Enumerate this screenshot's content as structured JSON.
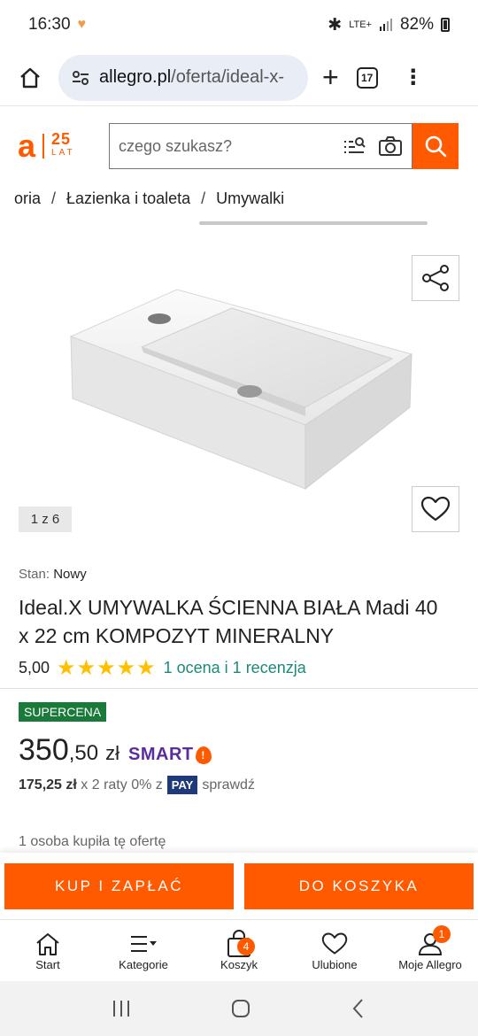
{
  "status_bar": {
    "time": "16:30",
    "network": "LTE+",
    "battery": "82%"
  },
  "browser": {
    "url_domain": "allegro.pl",
    "url_path": "/oferta/ideal-x-",
    "tab_count": "17"
  },
  "header": {
    "logo_letter": "a",
    "anniversary_number": "25",
    "anniversary_word": "LAT",
    "search_placeholder": "czego szukasz?"
  },
  "breadcrumb": {
    "items": [
      "oria",
      "Łazienka i toaleta",
      "Umywalki"
    ],
    "separator": "/"
  },
  "gallery": {
    "counter": "1 z 6"
  },
  "product": {
    "condition_label": "Stan:",
    "condition_value": "Nowy",
    "title": "Ideal.X UMYWALKA ŚCIENNA BIAŁA Madi 40 x 22 cm KOMPOZYT MINERALNY",
    "rating_value": "5,00",
    "stars": "★★★★★",
    "rating_link": "1 ocena i 1 recenzja",
    "badge": "SUPERCENA",
    "price_int": "350",
    "price_dec": ",50",
    "currency": "zł",
    "smart_label": "SMART",
    "installment_amount": "175,25 zł",
    "installment_text": "x 2 raty 0% z",
    "pay_label": "PAY",
    "installment_check": "sprawdź",
    "bought_text": "1 osoba kupiła tę ofertę"
  },
  "actions": {
    "buy_now": "KUP I ZAPŁAĆ",
    "add_to_cart": "DO KOSZYKA"
  },
  "bottom_nav": {
    "items": [
      {
        "label": "Start",
        "icon": "home-icon"
      },
      {
        "label": "Kategorie",
        "icon": "menu-icon"
      },
      {
        "label": "Koszyk",
        "icon": "cart-icon",
        "badge": "4"
      },
      {
        "label": "Ulubione",
        "icon": "heart-icon"
      },
      {
        "label": "Moje Allegro",
        "icon": "user-icon",
        "badge": "1"
      }
    ]
  },
  "colors": {
    "brand": "#ff5a00",
    "rating_star": "#ffc000",
    "link": "#1a8a78",
    "supercena": "#1a7a3a",
    "smart": "#5a2d9c"
  }
}
